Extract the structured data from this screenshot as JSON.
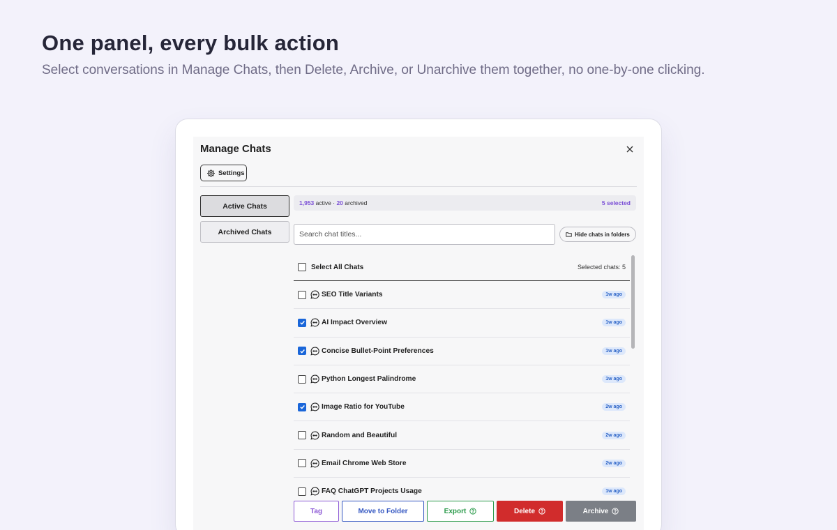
{
  "hero": {
    "title": "One panel, every bulk action",
    "subtitle": "Select conversations in Manage Chats, then Delete, Archive, or Unarchive them together, no one-by-one clicking."
  },
  "panel": {
    "title": "Manage Chats",
    "settings_label": "Settings",
    "tabs": [
      {
        "label": "Active Chats",
        "active": true
      },
      {
        "label": "Archived Chats",
        "active": false
      }
    ],
    "stats": {
      "active_count": "1,953",
      "active_label": "active ·",
      "archived_count": "20",
      "archived_label": "archived",
      "selected": "5 selected"
    },
    "search": {
      "placeholder": "Search chat titles..."
    },
    "hide_folders_label": "Hide chats in folders",
    "list": {
      "select_all_label": "Select All Chats",
      "selected_text": "Selected chats: 5",
      "rows": [
        {
          "title": "SEO Title Variants",
          "age": "1w ago",
          "checked": false
        },
        {
          "title": "AI Impact Overview",
          "age": "1w ago",
          "checked": true
        },
        {
          "title": "Concise Bullet-Point Preferences",
          "age": "1w ago",
          "checked": true
        },
        {
          "title": "Python Longest Palindrome",
          "age": "1w ago",
          "checked": false
        },
        {
          "title": "Image Ratio for YouTube",
          "age": "2w ago",
          "checked": true
        },
        {
          "title": "Random and Beautiful",
          "age": "2w ago",
          "checked": false
        },
        {
          "title": "Email Chrome Web Store",
          "age": "2w ago",
          "checked": false
        },
        {
          "title": "FAQ ChatGPT Projects Usage",
          "age": "1w ago",
          "checked": false
        }
      ]
    },
    "actions": {
      "tag": "Tag",
      "move": "Move to Folder",
      "export": "Export",
      "delete": "Delete",
      "archive": "Archive"
    }
  }
}
